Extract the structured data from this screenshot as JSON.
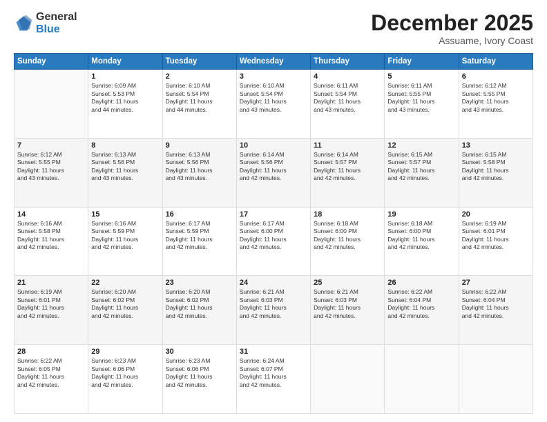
{
  "logo": {
    "general": "General",
    "blue": "Blue"
  },
  "header": {
    "month": "December 2025",
    "location": "Assuame, Ivory Coast"
  },
  "weekdays": [
    "Sunday",
    "Monday",
    "Tuesday",
    "Wednesday",
    "Thursday",
    "Friday",
    "Saturday"
  ],
  "weeks": [
    [
      {
        "day": "",
        "info": ""
      },
      {
        "day": "1",
        "info": "Sunrise: 6:09 AM\nSunset: 5:53 PM\nDaylight: 11 hours\nand 44 minutes."
      },
      {
        "day": "2",
        "info": "Sunrise: 6:10 AM\nSunset: 5:54 PM\nDaylight: 11 hours\nand 44 minutes."
      },
      {
        "day": "3",
        "info": "Sunrise: 6:10 AM\nSunset: 5:54 PM\nDaylight: 11 hours\nand 43 minutes."
      },
      {
        "day": "4",
        "info": "Sunrise: 6:11 AM\nSunset: 5:54 PM\nDaylight: 11 hours\nand 43 minutes."
      },
      {
        "day": "5",
        "info": "Sunrise: 6:11 AM\nSunset: 5:55 PM\nDaylight: 11 hours\nand 43 minutes."
      },
      {
        "day": "6",
        "info": "Sunrise: 6:12 AM\nSunset: 5:55 PM\nDaylight: 11 hours\nand 43 minutes."
      }
    ],
    [
      {
        "day": "7",
        "info": "Sunrise: 6:12 AM\nSunset: 5:55 PM\nDaylight: 11 hours\nand 43 minutes."
      },
      {
        "day": "8",
        "info": "Sunrise: 6:13 AM\nSunset: 5:56 PM\nDaylight: 11 hours\nand 43 minutes."
      },
      {
        "day": "9",
        "info": "Sunrise: 6:13 AM\nSunset: 5:56 PM\nDaylight: 11 hours\nand 43 minutes."
      },
      {
        "day": "10",
        "info": "Sunrise: 6:14 AM\nSunset: 5:56 PM\nDaylight: 11 hours\nand 42 minutes."
      },
      {
        "day": "11",
        "info": "Sunrise: 6:14 AM\nSunset: 5:57 PM\nDaylight: 11 hours\nand 42 minutes."
      },
      {
        "day": "12",
        "info": "Sunrise: 6:15 AM\nSunset: 5:57 PM\nDaylight: 11 hours\nand 42 minutes."
      },
      {
        "day": "13",
        "info": "Sunrise: 6:15 AM\nSunset: 5:58 PM\nDaylight: 11 hours\nand 42 minutes."
      }
    ],
    [
      {
        "day": "14",
        "info": "Sunrise: 6:16 AM\nSunset: 5:58 PM\nDaylight: 11 hours\nand 42 minutes."
      },
      {
        "day": "15",
        "info": "Sunrise: 6:16 AM\nSunset: 5:59 PM\nDaylight: 11 hours\nand 42 minutes."
      },
      {
        "day": "16",
        "info": "Sunrise: 6:17 AM\nSunset: 5:59 PM\nDaylight: 11 hours\nand 42 minutes."
      },
      {
        "day": "17",
        "info": "Sunrise: 6:17 AM\nSunset: 6:00 PM\nDaylight: 11 hours\nand 42 minutes."
      },
      {
        "day": "18",
        "info": "Sunrise: 6:18 AM\nSunset: 6:00 PM\nDaylight: 11 hours\nand 42 minutes."
      },
      {
        "day": "19",
        "info": "Sunrise: 6:18 AM\nSunset: 6:00 PM\nDaylight: 11 hours\nand 42 minutes."
      },
      {
        "day": "20",
        "info": "Sunrise: 6:19 AM\nSunset: 6:01 PM\nDaylight: 11 hours\nand 42 minutes."
      }
    ],
    [
      {
        "day": "21",
        "info": "Sunrise: 6:19 AM\nSunset: 6:01 PM\nDaylight: 11 hours\nand 42 minutes."
      },
      {
        "day": "22",
        "info": "Sunrise: 6:20 AM\nSunset: 6:02 PM\nDaylight: 11 hours\nand 42 minutes."
      },
      {
        "day": "23",
        "info": "Sunrise: 6:20 AM\nSunset: 6:02 PM\nDaylight: 11 hours\nand 42 minutes."
      },
      {
        "day": "24",
        "info": "Sunrise: 6:21 AM\nSunset: 6:03 PM\nDaylight: 11 hours\nand 42 minutes."
      },
      {
        "day": "25",
        "info": "Sunrise: 6:21 AM\nSunset: 6:03 PM\nDaylight: 11 hours\nand 42 minutes."
      },
      {
        "day": "26",
        "info": "Sunrise: 6:22 AM\nSunset: 6:04 PM\nDaylight: 11 hours\nand 42 minutes."
      },
      {
        "day": "27",
        "info": "Sunrise: 6:22 AM\nSunset: 6:04 PM\nDaylight: 11 hours\nand 42 minutes."
      }
    ],
    [
      {
        "day": "28",
        "info": "Sunrise: 6:22 AM\nSunset: 6:05 PM\nDaylight: 11 hours\nand 42 minutes."
      },
      {
        "day": "29",
        "info": "Sunrise: 6:23 AM\nSunset: 6:06 PM\nDaylight: 11 hours\nand 42 minutes."
      },
      {
        "day": "30",
        "info": "Sunrise: 6:23 AM\nSunset: 6:06 PM\nDaylight: 11 hours\nand 42 minutes."
      },
      {
        "day": "31",
        "info": "Sunrise: 6:24 AM\nSunset: 6:07 PM\nDaylight: 11 hours\nand 42 minutes."
      },
      {
        "day": "",
        "info": ""
      },
      {
        "day": "",
        "info": ""
      },
      {
        "day": "",
        "info": ""
      }
    ]
  ]
}
